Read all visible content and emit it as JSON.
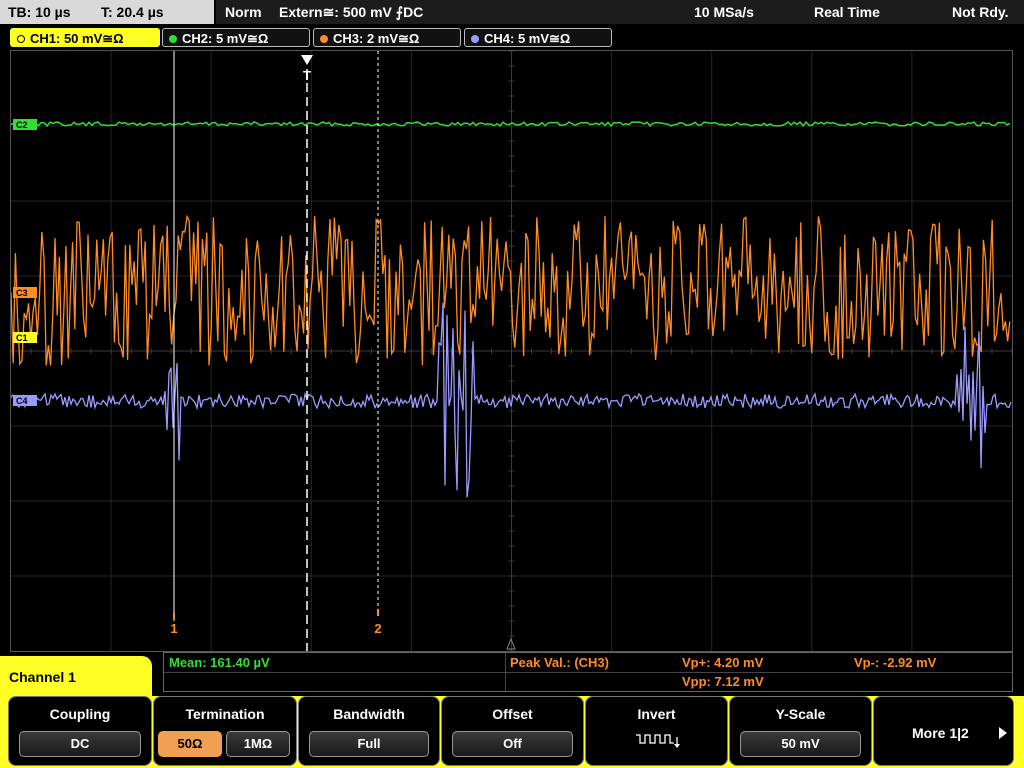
{
  "header": {
    "timebase": "TB: 10 µs",
    "trigger_time": "T: 20.4 µs",
    "trigger_mode": "Norm",
    "trigger_source": "Extern≅: 500 mV ⨍DC",
    "sample_rate": "10 MSa/s",
    "acq_mode": "Real Time",
    "status": "Not Rdy."
  },
  "tabs": [
    {
      "label": "CH1: 50 mV≅Ω",
      "color": "#ffff26",
      "active": true
    },
    {
      "label": "CH2: 5 mV≅Ω",
      "color": "#33dd33",
      "active": false
    },
    {
      "label": "CH3: 2 mV≅Ω",
      "color": "#ff8c26",
      "active": false
    },
    {
      "label": "CH4: 5 mV≅Ω",
      "color": "#9b9bff",
      "active": false
    }
  ],
  "screen": {
    "ch2_marker": "C2",
    "ch3_marker": "C3",
    "ch1_marker": "C1",
    "ch4_marker": "C4",
    "trigger_marker": "T",
    "cursor1_label": "1",
    "cursor2_label": "2"
  },
  "measurements": {
    "mean": "Mean: 161.40 µV",
    "peak_label": "Peak Val.: (CH3)",
    "vp_plus": "Vp+: 4.20 mV",
    "vp_minus": "Vp-: -2.92 mV",
    "vpp": "Vpp: 7.12 mV"
  },
  "menu_title": "Channel 1",
  "softkeys": {
    "coupling": {
      "title": "Coupling",
      "value": "DC"
    },
    "termination": {
      "title": "Termination",
      "option1": "50Ω",
      "option2": "1MΩ"
    },
    "bandwidth": {
      "title": "Bandwidth",
      "value": "Full"
    },
    "offset": {
      "title": "Offset",
      "value": "Off"
    },
    "invert": {
      "title": "Invert"
    },
    "yscale": {
      "title": "Y-Scale",
      "value": "50 mV"
    },
    "more": {
      "label": "More 1|2"
    }
  },
  "colors": {
    "ch1": "#ffff26",
    "ch2": "#33dd33",
    "ch3": "#ff8c26",
    "ch4": "#9b9bff",
    "mean_text": "#33dd33",
    "peak_text": "#ff8c26"
  }
}
